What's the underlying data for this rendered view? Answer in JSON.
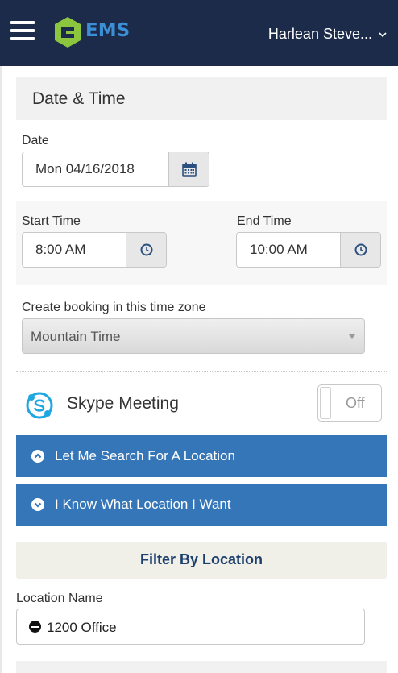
{
  "header": {
    "brand": "EMS",
    "user_name": "Harlean Steve..."
  },
  "date_time": {
    "section_title": "Date & Time",
    "date_label": "Date",
    "date_value": "Mon 04/16/2018",
    "start_label": "Start Time",
    "start_value": "8:00 AM",
    "end_label": "End Time",
    "end_value": "10:00 AM",
    "timezone_label": "Create booking in this time zone",
    "timezone_value": "Mountain Time"
  },
  "skype": {
    "label": "Skype Meeting",
    "toggle_text": "Off"
  },
  "location": {
    "search_label": "Let Me Search For A Location",
    "know_label": "I Know What Location I Want",
    "filter_label": "Filter By Location",
    "name_label": "Location Name",
    "selected": "1200 Office"
  },
  "colors": {
    "header_bg": "#1c2b4a",
    "accent_blue": "#3476b8",
    "logo_green": "#8cc63f",
    "filter_text": "#1c3f6e"
  }
}
